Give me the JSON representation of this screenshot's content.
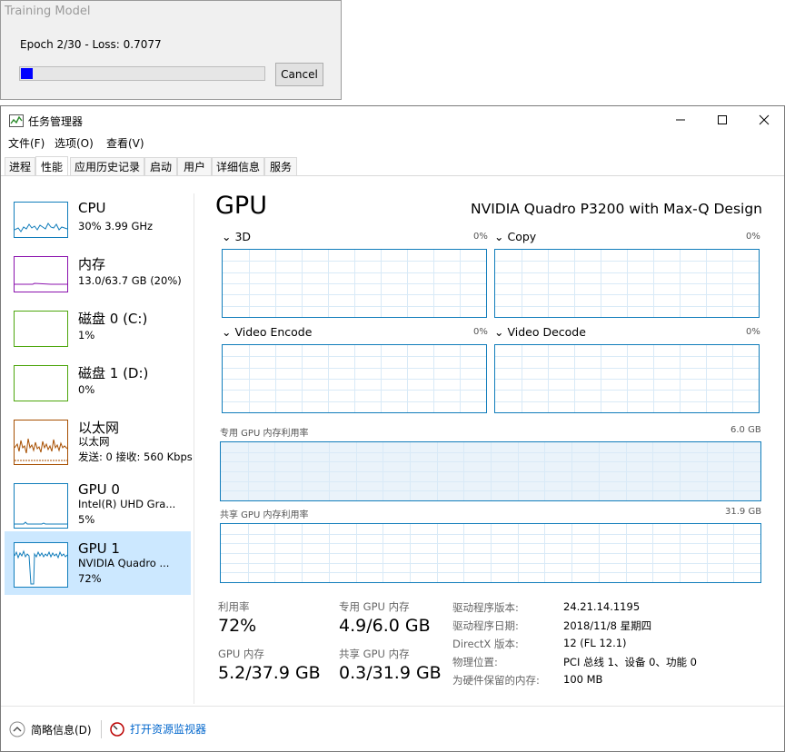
{
  "dialog": {
    "title": "Training Model",
    "status": "Epoch 2/30   - Loss: 0.7077",
    "progress": 0.05,
    "cancel_label": "Cancel"
  },
  "taskmgr": {
    "title": "任务管理器",
    "menu": [
      "文件(F)",
      "选项(O)",
      "查看(V)"
    ],
    "tabs": [
      "进程",
      "性能",
      "应用历史记录",
      "启动",
      "用户",
      "详细信息",
      "服务"
    ],
    "selected_tab": "性能",
    "sidebar": [
      {
        "name": "CPU",
        "line1": "30%  3.99 GHz",
        "line2": "",
        "color": "#117dbb"
      },
      {
        "name": "内存",
        "line1": "13.0/63.7 GB (20%)",
        "line2": "",
        "color": "#8b12ae"
      },
      {
        "name": "磁盘 0 (C:)",
        "line1": "1%",
        "line2": "",
        "color": "#4da60c"
      },
      {
        "name": "磁盘 1 (D:)",
        "line1": "0%",
        "line2": "",
        "color": "#4da60c"
      },
      {
        "name": "以太网",
        "line1": "以太网",
        "line2": "发送: 0  接收: 560 Kbps",
        "color": "#a74f01"
      },
      {
        "name": "GPU 0",
        "line1": "Intel(R) UHD Gra...",
        "line2": "5%",
        "color": "#117dbb"
      },
      {
        "name": "GPU 1",
        "line1": "NVIDIA Quadro ...",
        "line2": "72%",
        "color": "#117dbb"
      }
    ],
    "gpu": {
      "heading": "GPU",
      "model": "NVIDIA Quadro P3200 with Max-Q Design",
      "engines": [
        {
          "label": "3D",
          "pct": "0%"
        },
        {
          "label": "Copy",
          "pct": "0%"
        },
        {
          "label": "Video Encode",
          "pct": "0%"
        },
        {
          "label": "Video Decode",
          "pct": "0%"
        }
      ],
      "dedicated_label": "专用 GPU 内存利用率",
      "dedicated_max": "6.0 GB",
      "shared_label": "共享 GPU 内存利用率",
      "shared_max": "31.9 GB",
      "stats": [
        {
          "label": "利用率",
          "value": "72%"
        },
        {
          "label": "专用 GPU 内存",
          "value": "4.9/6.0 GB"
        },
        {
          "label": "GPU 内存",
          "value": "5.2/37.9 GB"
        },
        {
          "label": "共享 GPU 内存",
          "value": "0.3/31.9 GB"
        }
      ],
      "info": [
        {
          "k": "驱动程序版本:",
          "v": "24.21.14.1195"
        },
        {
          "k": "驱动程序日期:",
          "v": "2018/11/8 星期四"
        },
        {
          "k": "DirectX 版本:",
          "v": "12 (FL 12.1)"
        },
        {
          "k": "物理位置:",
          "v": "PCI 总线 1、设备 0、功能 0"
        },
        {
          "k": "为硬件保留的内存:",
          "v": "100 MB"
        }
      ]
    },
    "footer": {
      "brief": "简略信息(D)",
      "monitor": "打开资源监视器"
    }
  }
}
